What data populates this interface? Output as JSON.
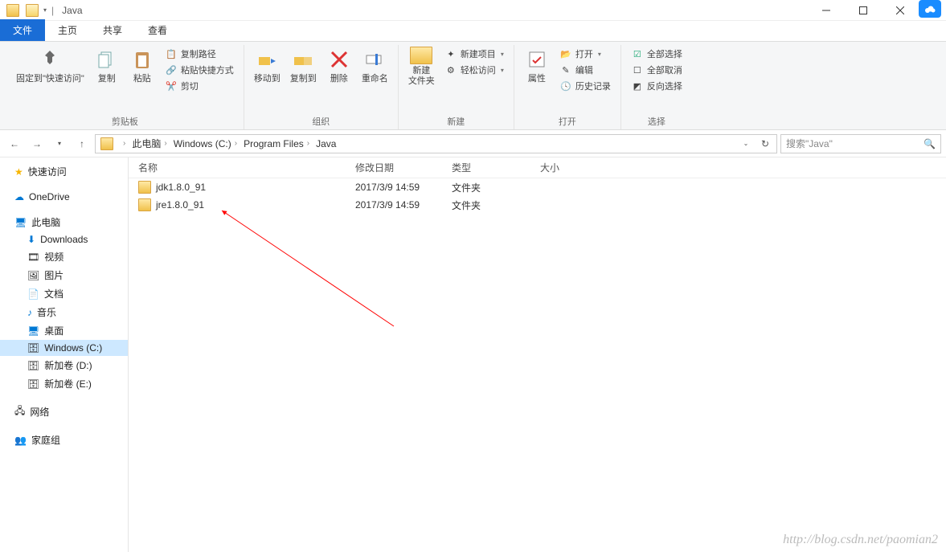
{
  "window": {
    "title": "Java"
  },
  "tabs": {
    "file": "文件",
    "home": "主页",
    "share": "共享",
    "view": "查看"
  },
  "ribbon": {
    "pin": "固定到\"快速访问\"",
    "copy": "复制",
    "paste": "粘贴",
    "copy_path": "复制路径",
    "paste_shortcut": "粘贴快捷方式",
    "cut": "剪切",
    "clipboard": "剪贴板",
    "move_to": "移动到",
    "copy_to": "复制到",
    "delete": "删除",
    "rename": "重命名",
    "organize": "组织",
    "new_folder": "新建\n文件夹",
    "new_item": "新建项目",
    "easy_access": "轻松访问",
    "new": "新建",
    "properties": "属性",
    "open": "打开",
    "edit": "编辑",
    "history": "历史记录",
    "open_grp": "打开",
    "select_all": "全部选择",
    "select_none": "全部取消",
    "invert": "反向选择",
    "select": "选择"
  },
  "breadcrumb": {
    "pc": "此电脑",
    "drive": "Windows (C:)",
    "pf": "Program Files",
    "java": "Java"
  },
  "search": {
    "placeholder": "搜索\"Java\""
  },
  "tree": {
    "quick": "快速访问",
    "onedrive": "OneDrive",
    "pc": "此电脑",
    "downloads": "Downloads",
    "videos": "视频",
    "pictures": "图片",
    "documents": "文档",
    "music": "音乐",
    "desktop": "桌面",
    "c": "Windows (C:)",
    "d": "新加卷 (D:)",
    "e": "新加卷 (E:)",
    "network": "网络",
    "homegroup": "家庭组"
  },
  "columns": {
    "name": "名称",
    "modified": "修改日期",
    "type": "类型",
    "size": "大小"
  },
  "rows": [
    {
      "name": "jdk1.8.0_91",
      "date": "2017/3/9 14:59",
      "type": "文件夹"
    },
    {
      "name": "jre1.8.0_91",
      "date": "2017/3/9 14:59",
      "type": "文件夹"
    }
  ],
  "watermark": "http://blog.csdn.net/paomian2"
}
